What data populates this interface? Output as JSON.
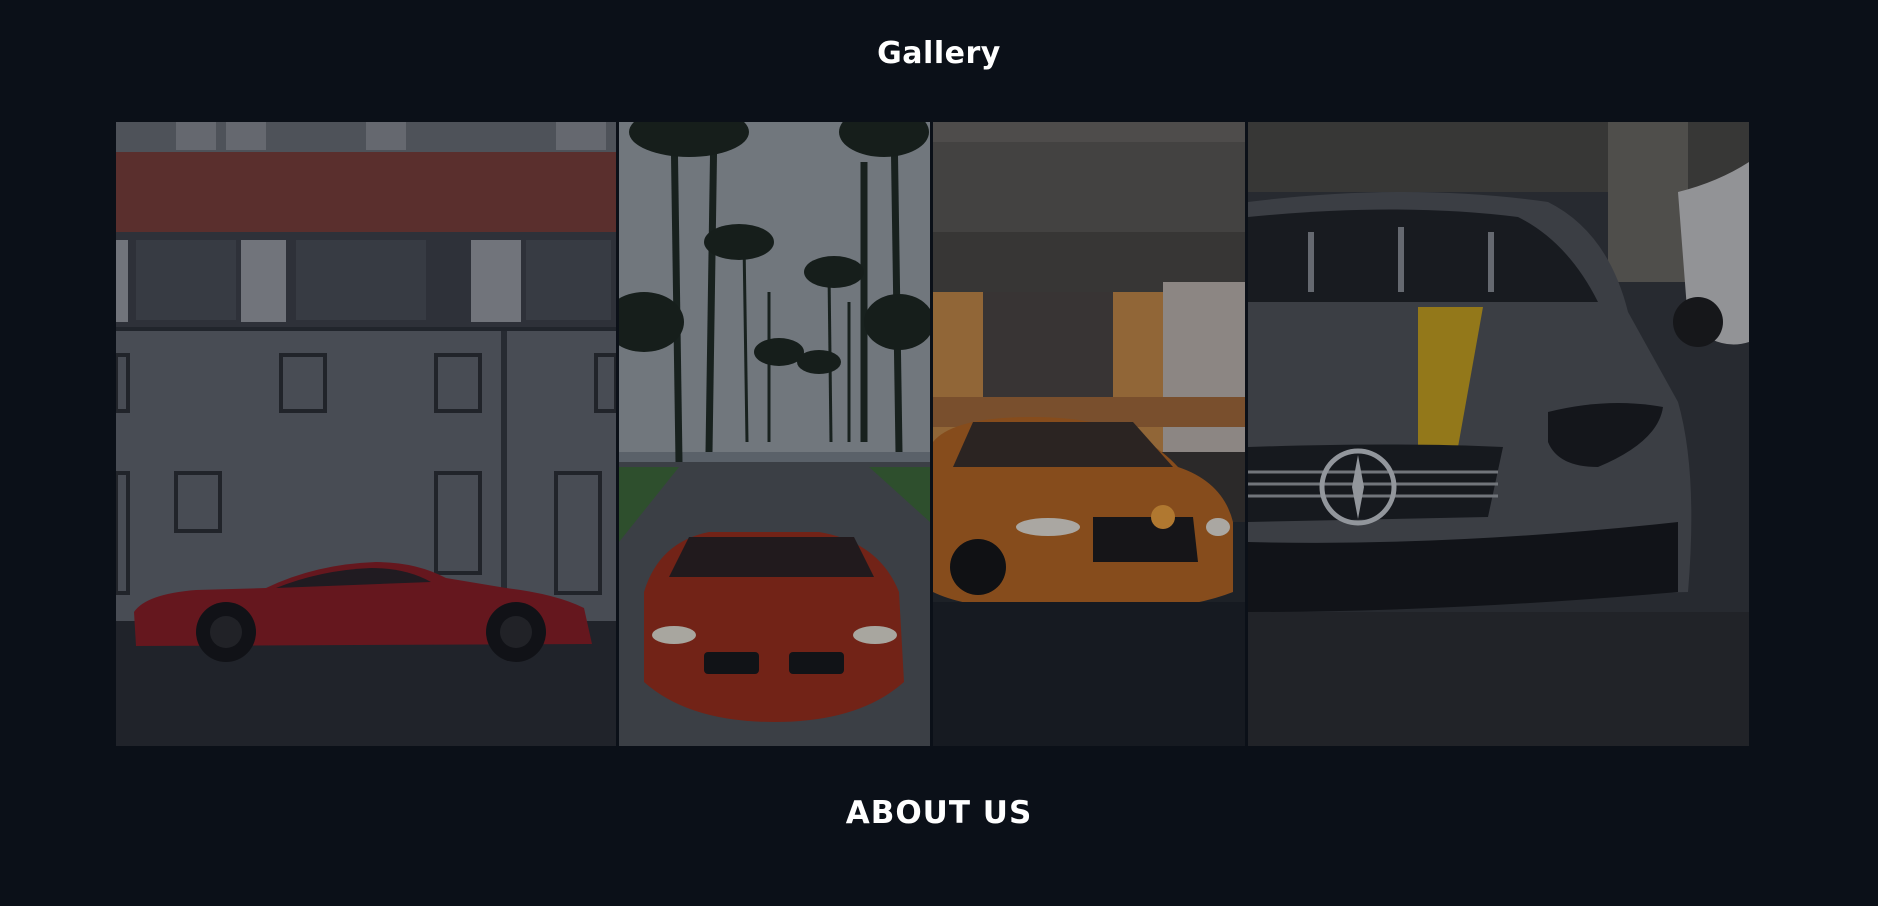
{
  "gallery": {
    "title": "Gallery",
    "images": [
      {
        "subject": "red-coupe-in-front-of-building",
        "icon": "photo-red-coupe"
      },
      {
        "subject": "red-bmw-on-palm-tree-street",
        "icon": "photo-red-bmw"
      },
      {
        "subject": "orange-audi-under-bridge",
        "icon": "photo-orange-audi"
      },
      {
        "subject": "grey-mercedes-with-yellow-stripe",
        "icon": "photo-grey-mercedes"
      }
    ]
  },
  "about": {
    "title": "ABOUT US"
  },
  "colors": {
    "background": "#0b1018",
    "text": "#ffffff",
    "accent_red": "#a3191f",
    "accent_orange": "#d9702a",
    "accent_yellow": "#d6b21e"
  }
}
